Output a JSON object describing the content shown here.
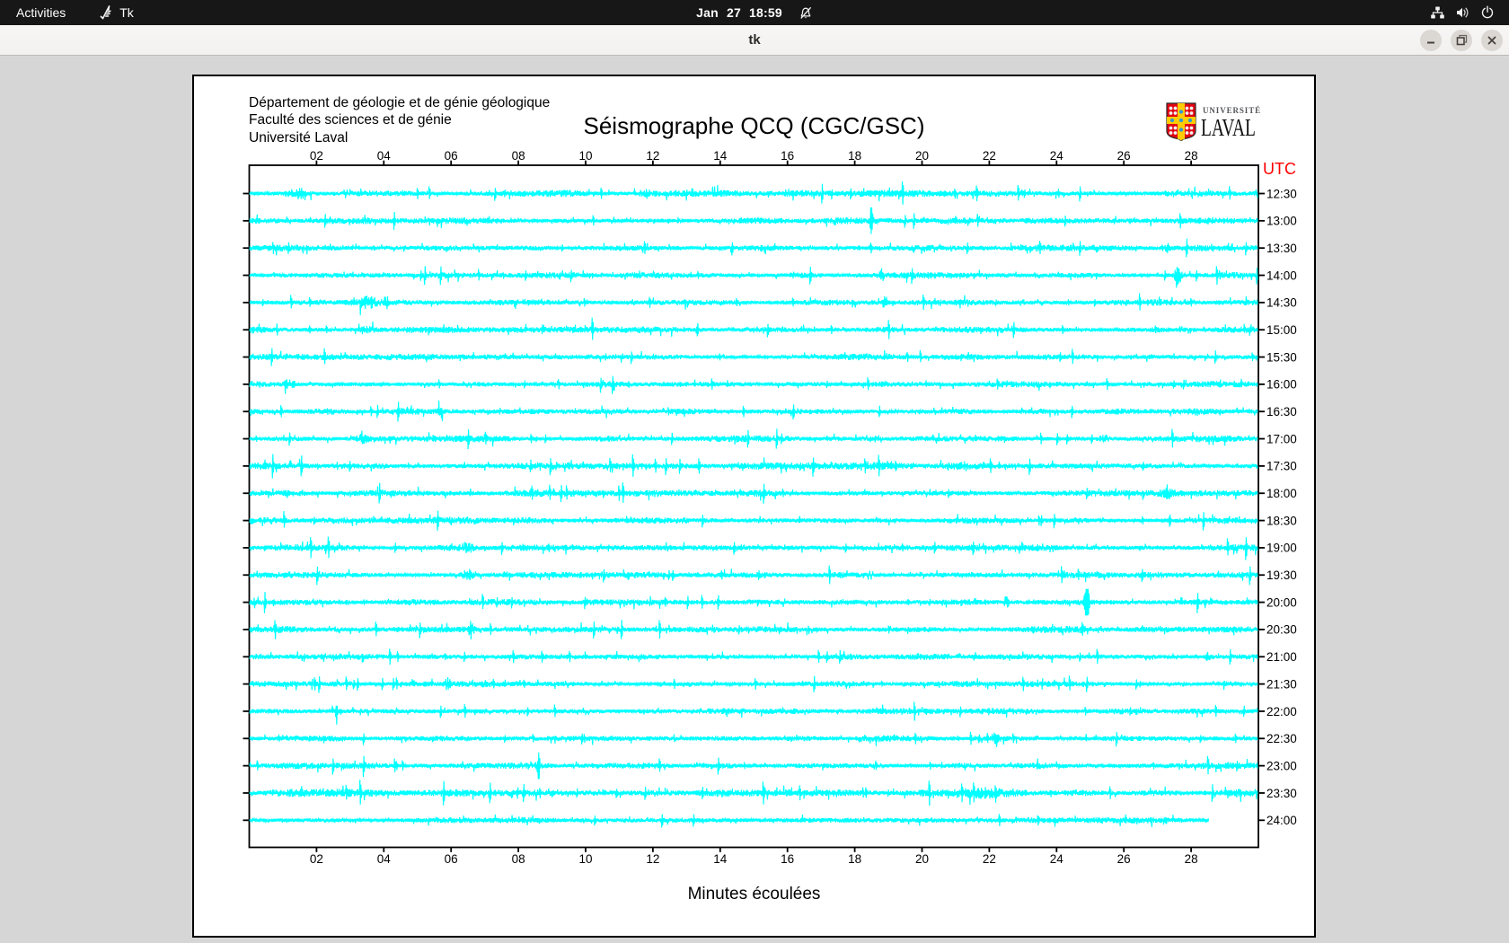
{
  "top_bar": {
    "activities_label": "Activities",
    "app_name": "Tk",
    "clock": "Jan 27 18:59",
    "icons": [
      "tk-feather-icon",
      "notifications-off-icon",
      "network-wired-icon",
      "volume-icon",
      "power-icon"
    ]
  },
  "title_bar": {
    "title": "tk",
    "buttons": [
      "minimize",
      "restore",
      "close"
    ]
  },
  "header": {
    "address_line1": "Département de géologie et de génie géologique",
    "address_line2": "Faculté des sciences et de génie",
    "address_line3": "Université Laval",
    "logo_line1": "UNIVERSITÉ",
    "logo_line2": "LAVAL"
  },
  "colors": {
    "trace": "#00ffff",
    "utc_label": "#ff0000",
    "axis": "#000000",
    "panel_bg": "#ffffff",
    "window_bg": "#d6d6d6",
    "topbar_bg": "#171717",
    "titlebar_bg": "#f6f5f4",
    "logo_red": "#e30513",
    "logo_gold": "#ffcb05",
    "logo_blue": "#2f9ad0"
  },
  "chart_data": {
    "type": "line",
    "subtype": "helicorder-seismogram",
    "title": "Séismographe QCQ (CGC/GSC)",
    "xlabel": "Minutes écoulées",
    "right_axis_label": "UTC",
    "xlim": [
      0,
      30
    ],
    "x_tick_minutes": [
      2,
      4,
      6,
      8,
      10,
      12,
      14,
      16,
      18,
      20,
      22,
      24,
      26,
      28
    ],
    "x_tick_labels": [
      "02",
      "04",
      "06",
      "08",
      "10",
      "12",
      "14",
      "16",
      "18",
      "20",
      "22",
      "24",
      "26",
      "28"
    ],
    "trace_color": "#00ffff",
    "minutes_per_row": 30,
    "rows": [
      {
        "utc": "12:30",
        "end_minute": 30,
        "amp": 2.1,
        "bursts": [
          [
            1.5,
            1.6,
            0.5
          ],
          [
            11.8,
            1.2,
            0.4
          ]
        ]
      },
      {
        "utc": "13:00",
        "end_minute": 30,
        "amp": 2.0,
        "bursts": [
          [
            18.5,
            2.6,
            0.12
          ]
        ]
      },
      {
        "utc": "13:30",
        "end_minute": 30,
        "amp": 2.0,
        "bursts": [
          [
            27.3,
            2.0,
            0.15
          ]
        ]
      },
      {
        "utc": "14:00",
        "end_minute": 30,
        "amp": 2.0,
        "bursts": [
          [
            18.8,
            1.8,
            0.12
          ],
          [
            27.6,
            7.5,
            0.16
          ]
        ]
      },
      {
        "utc": "14:30",
        "end_minute": 30,
        "amp": 2.0,
        "bursts": [
          [
            3.5,
            1.2,
            0.5
          ],
          [
            18.9,
            3.0,
            0.12
          ]
        ]
      },
      {
        "utc": "15:00",
        "end_minute": 30,
        "amp": 1.9,
        "bursts": [
          [
            3.5,
            1.8,
            0.5
          ]
        ]
      },
      {
        "utc": "15:30",
        "end_minute": 30,
        "amp": 1.9,
        "bursts": []
      },
      {
        "utc": "16:00",
        "end_minute": 30,
        "amp": 2.0,
        "bursts": [
          [
            1.2,
            2.4,
            0.35
          ]
        ]
      },
      {
        "utc": "16:30",
        "end_minute": 30,
        "amp": 1.9,
        "bursts": [
          [
            5.7,
            2.2,
            0.12
          ]
        ]
      },
      {
        "utc": "17:00",
        "end_minute": 30,
        "amp": 2.0,
        "bursts": [
          [
            3.4,
            1.5,
            0.3
          ],
          [
            25.4,
            1.5,
            0.3
          ]
        ]
      },
      {
        "utc": "17:30",
        "end_minute": 30,
        "amp": 2.3,
        "bursts": []
      },
      {
        "utc": "18:00",
        "end_minute": 30,
        "amp": 2.1,
        "bursts": [
          [
            27.3,
            1.8,
            0.25
          ]
        ]
      },
      {
        "utc": "18:30",
        "end_minute": 30,
        "amp": 2.2,
        "bursts": []
      },
      {
        "utc": "19:00",
        "end_minute": 30,
        "amp": 2.1,
        "bursts": [
          [
            6.5,
            1.4,
            0.3
          ]
        ]
      },
      {
        "utc": "19:30",
        "end_minute": 30,
        "amp": 2.0,
        "bursts": [
          [
            6.5,
            2.2,
            0.3
          ]
        ]
      },
      {
        "utc": "20:00",
        "end_minute": 30,
        "amp": 2.0,
        "bursts": [
          [
            22.5,
            3.5,
            0.12
          ],
          [
            24.9,
            8.0,
            0.13
          ]
        ]
      },
      {
        "utc": "20:30",
        "end_minute": 30,
        "amp": 2.0,
        "bursts": [
          [
            6.6,
            3.5,
            0.12
          ]
        ]
      },
      {
        "utc": "21:00",
        "end_minute": 30,
        "amp": 1.9,
        "bursts": [
          [
            28.5,
            2.2,
            0.12
          ]
        ]
      },
      {
        "utc": "21:30",
        "end_minute": 30,
        "amp": 1.9,
        "bursts": [
          [
            5.9,
            1.8,
            0.12
          ],
          [
            29.0,
            2.0,
            0.12
          ]
        ]
      },
      {
        "utc": "22:00",
        "end_minute": 30,
        "amp": 1.9,
        "bursts": [
          [
            2.6,
            3.2,
            0.2
          ]
        ]
      },
      {
        "utc": "22:30",
        "end_minute": 30,
        "amp": 1.9,
        "bursts": [
          [
            22.2,
            2.4,
            0.12
          ]
        ]
      },
      {
        "utc": "23:00",
        "end_minute": 30,
        "amp": 1.9,
        "bursts": [
          [
            8.6,
            1.8,
            0.12
          ]
        ]
      },
      {
        "utc": "23:30",
        "end_minute": 30,
        "amp": 2.3,
        "bursts": [
          [
            21.5,
            1.5,
            1.5
          ]
        ]
      },
      {
        "utc": "24:00",
        "end_minute": 28.55,
        "amp": 1.8,
        "bursts": []
      }
    ],
    "noise_seed": 1327
  }
}
